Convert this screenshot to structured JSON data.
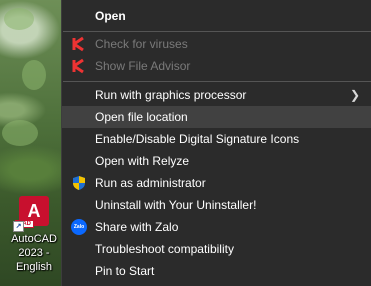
{
  "desktop": {
    "shortcut_label_line1": "AutoCAD",
    "shortcut_label_line2": "2023 -",
    "shortcut_label_line3": "English",
    "app_icon_letter": "A",
    "app_icon_tag": "CAD"
  },
  "menu": {
    "items": [
      {
        "label": "Open"
      },
      {
        "label": "Check for viruses"
      },
      {
        "label": "Show File Advisor"
      },
      {
        "label": "Run with graphics processor"
      },
      {
        "label": "Open file location"
      },
      {
        "label": "Enable/Disable Digital Signature Icons"
      },
      {
        "label": "Open with Relyze"
      },
      {
        "label": "Run as administrator"
      },
      {
        "label": "Uninstall with Your Uninstaller!"
      },
      {
        "label": "Share with Zalo"
      },
      {
        "label": "Troubleshoot compatibility"
      },
      {
        "label": "Pin to Start"
      }
    ],
    "zalo_icon_text": "Zalo",
    "colors": {
      "background": "#2b2b2b",
      "highlight": "#414141",
      "disabled_text": "#7a7a7a"
    }
  }
}
